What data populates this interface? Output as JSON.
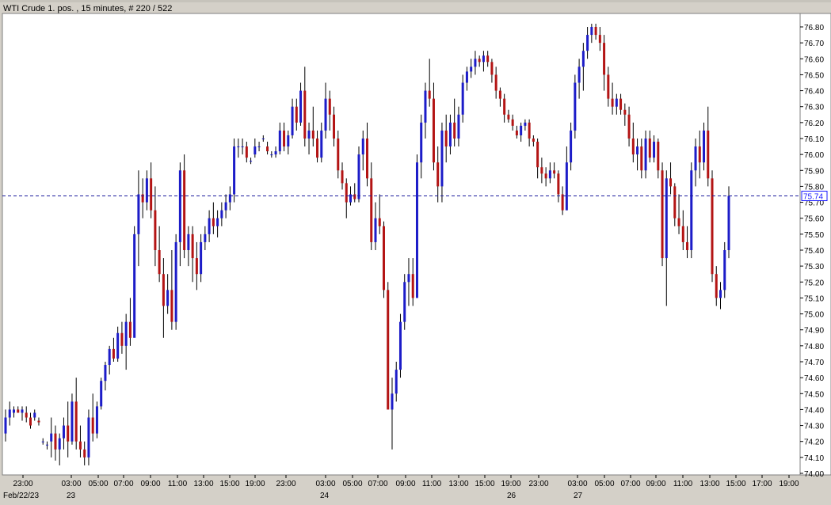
{
  "title": "WTI Crude 1. pos. , 15 minutes, # 220 / 522",
  "colors": {
    "up": "#1c1cc8",
    "down": "#b31414",
    "current_line": "#1a1a9c",
    "plot_bg": "#ffffff",
    "frame_bg": "#d4d0c8"
  },
  "chart_data": {
    "type": "candlestick",
    "timeframe": "15 minutes",
    "ylim": [
      74.0,
      76.85
    ],
    "y_ticks": [
      "74.00",
      "74.10",
      "74.20",
      "74.30",
      "74.40",
      "74.50",
      "74.60",
      "74.70",
      "74.80",
      "74.90",
      "75.00",
      "75.10",
      "75.20",
      "75.30",
      "75.40",
      "75.50",
      "75.60",
      "75.70",
      "75.80",
      "75.90",
      "76.00",
      "76.10",
      "76.20",
      "76.30",
      "76.40",
      "76.50",
      "76.60",
      "76.70",
      "76.80"
    ],
    "x_ticks": [
      "23:00",
      "03:00",
      "05:00",
      "07:00",
      "09:00",
      "11:00",
      "13:00",
      "15:00",
      "19:00",
      "23:00",
      "03:00",
      "05:00",
      "07:00",
      "09:00",
      "11:00",
      "13:00",
      "15:00",
      "19:00",
      "23:00",
      "03:00",
      "05:00",
      "07:00",
      "09:00",
      "11:00",
      "13:00",
      "15:00",
      "17:00",
      "19:00"
    ],
    "date_labels": [
      "Feb/22/23",
      "23",
      "24",
      "26",
      "27"
    ],
    "current_price": "75.74",
    "grid": false,
    "candles": [
      [
        74.25,
        74.4,
        74.2,
        74.35
      ],
      [
        74.35,
        74.45,
        74.3,
        74.4
      ],
      [
        74.38,
        74.42,
        74.35,
        74.4
      ],
      [
        74.4,
        74.42,
        74.38,
        74.38
      ],
      [
        74.38,
        74.42,
        74.33,
        74.4
      ],
      [
        74.38,
        74.42,
        74.32,
        74.35
      ],
      [
        74.35,
        74.38,
        74.28,
        74.3
      ],
      [
        74.35,
        74.4,
        74.33,
        74.38
      ],
      [
        74.33,
        74.35,
        74.3,
        74.32
      ],
      [
        74.2,
        74.22,
        74.18,
        74.2
      ],
      [
        74.18,
        74.2,
        74.15,
        74.18
      ],
      [
        74.2,
        74.35,
        74.1,
        74.25
      ],
      [
        74.25,
        74.3,
        74.08,
        74.15
      ],
      [
        74.15,
        74.25,
        74.05,
        74.22
      ],
      [
        74.22,
        74.35,
        74.15,
        74.3
      ],
      [
        74.3,
        74.45,
        74.1,
        74.2
      ],
      [
        74.2,
        74.5,
        74.18,
        74.45
      ],
      [
        74.45,
        74.6,
        74.15,
        74.2
      ],
      [
        74.2,
        74.3,
        74.1,
        74.15
      ],
      [
        74.15,
        74.2,
        74.05,
        74.1
      ],
      [
        74.1,
        74.4,
        74.05,
        74.35
      ],
      [
        74.35,
        74.5,
        74.2,
        74.25
      ],
      [
        74.25,
        74.45,
        74.22,
        74.42
      ],
      [
        74.42,
        74.6,
        74.4,
        74.58
      ],
      [
        74.58,
        74.7,
        74.52,
        74.68
      ],
      [
        74.68,
        74.8,
        74.62,
        74.78
      ],
      [
        74.78,
        74.85,
        74.7,
        74.72
      ],
      [
        74.72,
        74.92,
        74.7,
        74.88
      ],
      [
        74.88,
        74.95,
        74.75,
        74.8
      ],
      [
        74.8,
        75.0,
        74.65,
        74.95
      ],
      [
        74.95,
        75.1,
        74.8,
        74.85
      ],
      [
        74.85,
        75.55,
        74.9,
        75.5
      ],
      [
        75.5,
        75.9,
        75.3,
        75.75
      ],
      [
        75.75,
        75.85,
        75.6,
        75.7
      ],
      [
        75.7,
        75.9,
        75.65,
        75.85
      ],
      [
        75.85,
        75.95,
        75.6,
        75.65
      ],
      [
        75.65,
        75.8,
        75.3,
        75.4
      ],
      [
        75.4,
        75.55,
        75.2,
        75.25
      ],
      [
        75.25,
        75.35,
        74.85,
        75.05
      ],
      [
        75.05,
        75.25,
        75.0,
        75.15
      ],
      [
        75.15,
        75.4,
        74.9,
        74.95
      ],
      [
        74.95,
        75.5,
        74.9,
        75.45
      ],
      [
        75.45,
        75.95,
        75.3,
        75.9
      ],
      [
        75.9,
        76.0,
        75.35,
        75.4
      ],
      [
        75.4,
        75.55,
        75.3,
        75.5
      ],
      [
        75.5,
        75.55,
        75.2,
        75.35
      ],
      [
        75.35,
        75.45,
        75.15,
        75.25
      ],
      [
        75.25,
        75.5,
        75.2,
        75.45
      ],
      [
        75.45,
        75.55,
        75.4,
        75.5
      ],
      [
        75.5,
        75.65,
        75.45,
        75.6
      ],
      [
        75.6,
        75.7,
        75.5,
        75.55
      ],
      [
        75.55,
        75.65,
        75.48,
        75.6
      ],
      [
        75.6,
        75.7,
        75.55,
        75.65
      ],
      [
        75.65,
        75.75,
        75.6,
        75.7
      ],
      [
        75.7,
        75.8,
        75.65,
        75.75
      ],
      [
        75.75,
        76.1,
        75.7,
        76.05
      ],
      [
        76.05,
        76.1,
        75.98,
        76.05
      ],
      [
        76.05,
        76.1,
        76.0,
        76.05
      ],
      [
        76.05,
        76.08,
        75.95,
        75.98
      ],
      [
        75.96,
        75.98,
        75.94,
        75.96
      ],
      [
        76.0,
        76.1,
        75.98,
        76.05
      ],
      [
        76.05,
        76.08,
        76.02,
        76.05
      ],
      [
        76.1,
        76.12,
        76.08,
        76.1
      ],
      [
        76.05,
        76.08,
        76.0,
        76.02
      ],
      [
        76.0,
        76.02,
        75.98,
        76.0
      ],
      [
        76.0,
        76.05,
        75.98,
        76.02
      ],
      [
        76.02,
        76.2,
        76.0,
        76.15
      ],
      [
        76.15,
        76.2,
        76.02,
        76.05
      ],
      [
        76.05,
        76.15,
        76.0,
        76.12
      ],
      [
        76.12,
        76.35,
        76.1,
        76.3
      ],
      [
        76.3,
        76.35,
        76.15,
        76.2
      ],
      [
        76.2,
        76.45,
        76.18,
        76.4
      ],
      [
        76.4,
        76.55,
        76.05,
        76.1
      ],
      [
        76.1,
        76.2,
        76.0,
        76.15
      ],
      [
        76.15,
        76.3,
        76.05,
        76.1
      ],
      [
        76.1,
        76.15,
        75.95,
        75.98
      ],
      [
        75.98,
        76.2,
        75.95,
        76.15
      ],
      [
        76.15,
        76.45,
        76.1,
        76.35
      ],
      [
        76.35,
        76.4,
        76.15,
        76.25
      ],
      [
        76.25,
        76.3,
        76.05,
        76.1
      ],
      [
        76.1,
        76.15,
        75.85,
        75.9
      ],
      [
        75.9,
        75.95,
        75.78,
        75.82
      ],
      [
        75.82,
        75.85,
        75.6,
        75.7
      ],
      [
        75.7,
        75.8,
        75.68,
        75.75
      ],
      [
        75.75,
        75.82,
        75.7,
        75.72
      ],
      [
        75.72,
        76.05,
        75.7,
        76.0
      ],
      [
        76.0,
        76.15,
        75.9,
        76.1
      ],
      [
        76.1,
        76.2,
        75.8,
        75.85
      ],
      [
        75.85,
        75.95,
        75.4,
        75.45
      ],
      [
        75.45,
        75.7,
        75.4,
        75.6
      ],
      [
        75.6,
        75.75,
        75.5,
        75.55
      ],
      [
        75.55,
        75.58,
        75.1,
        75.15
      ],
      [
        75.15,
        75.2,
        74.65,
        74.4
      ],
      [
        74.4,
        74.6,
        74.15,
        74.5
      ],
      [
        74.5,
        74.7,
        74.45,
        74.65
      ],
      [
        74.65,
        75.0,
        74.6,
        74.95
      ],
      [
        74.95,
        75.25,
        74.9,
        75.2
      ],
      [
        75.2,
        75.35,
        75.05,
        75.25
      ],
      [
        75.25,
        75.35,
        75.05,
        75.1
      ],
      [
        75.1,
        76.0,
        75.1,
        75.95
      ],
      [
        75.95,
        76.25,
        75.85,
        76.2
      ],
      [
        76.2,
        76.45,
        76.1,
        76.4
      ],
      [
        76.4,
        76.6,
        76.3,
        76.35
      ],
      [
        76.35,
        76.45,
        75.9,
        75.95
      ],
      [
        75.95,
        76.05,
        75.7,
        75.8
      ],
      [
        75.8,
        76.2,
        75.7,
        76.15
      ],
      [
        76.15,
        76.25,
        75.95,
        76.05
      ],
      [
        76.05,
        76.25,
        76.0,
        76.2
      ],
      [
        76.2,
        76.35,
        76.05,
        76.1
      ],
      [
        76.1,
        76.3,
        76.05,
        76.25
      ],
      [
        76.25,
        76.5,
        76.2,
        76.45
      ],
      [
        76.45,
        76.55,
        76.4,
        76.52
      ],
      [
        76.52,
        76.6,
        76.48,
        76.55
      ],
      [
        76.55,
        76.65,
        76.5,
        76.6
      ],
      [
        76.6,
        76.62,
        76.55,
        76.58
      ],
      [
        76.58,
        76.65,
        76.52,
        76.62
      ],
      [
        76.62,
        76.65,
        76.55,
        76.58
      ],
      [
        76.58,
        76.6,
        76.45,
        76.5
      ],
      [
        76.5,
        76.55,
        76.35,
        76.4
      ],
      [
        76.4,
        76.42,
        76.3,
        76.35
      ],
      [
        76.35,
        76.38,
        76.2,
        76.25
      ],
      [
        76.25,
        76.28,
        76.2,
        76.22
      ],
      [
        76.22,
        76.25,
        76.15,
        76.18
      ],
      [
        76.15,
        76.18,
        76.1,
        76.12
      ],
      [
        76.12,
        76.2,
        76.08,
        76.18
      ],
      [
        76.18,
        76.22,
        76.15,
        76.2
      ],
      [
        76.2,
        76.22,
        76.05,
        76.1
      ],
      [
        76.1,
        76.12,
        76.05,
        76.08
      ],
      [
        76.08,
        76.1,
        75.85,
        75.92
      ],
      [
        75.92,
        75.98,
        75.82,
        75.88
      ],
      [
        75.88,
        75.92,
        75.8,
        75.85
      ],
      [
        75.85,
        75.95,
        75.82,
        75.9
      ],
      [
        75.9,
        75.95,
        75.85,
        75.88
      ],
      [
        75.88,
        75.9,
        75.7,
        75.75
      ],
      [
        75.75,
        75.8,
        75.62,
        75.65
      ],
      [
        75.65,
        76.05,
        75.65,
        75.95
      ],
      [
        75.95,
        76.2,
        75.9,
        76.15
      ],
      [
        76.15,
        76.5,
        76.1,
        76.45
      ],
      [
        76.45,
        76.6,
        76.35,
        76.55
      ],
      [
        76.55,
        76.7,
        76.4,
        76.65
      ],
      [
        76.65,
        76.8,
        76.6,
        76.75
      ],
      [
        76.75,
        76.82,
        76.7,
        76.8
      ],
      [
        76.8,
        76.82,
        76.72,
        76.75
      ],
      [
        76.75,
        76.8,
        76.65,
        76.7
      ],
      [
        76.7,
        76.75,
        76.4,
        76.5
      ],
      [
        76.5,
        76.55,
        76.3,
        76.35
      ],
      [
        76.35,
        76.45,
        76.25,
        76.3
      ],
      [
        76.3,
        76.38,
        76.25,
        76.35
      ],
      [
        76.35,
        76.38,
        76.25,
        76.28
      ],
      [
        76.28,
        76.32,
        76.18,
        76.25
      ],
      [
        76.25,
        76.3,
        76.05,
        76.1
      ],
      [
        76.1,
        76.2,
        75.95,
        76.0
      ],
      [
        76.0,
        76.1,
        75.9,
        76.05
      ],
      [
        76.05,
        76.1,
        75.85,
        75.9
      ],
      [
        75.9,
        76.15,
        75.85,
        76.1
      ],
      [
        76.1,
        76.15,
        75.95,
        75.98
      ],
      [
        75.98,
        76.12,
        75.95,
        76.08
      ],
      [
        76.08,
        76.1,
        75.85,
        75.9
      ],
      [
        75.9,
        75.95,
        75.3,
        75.35
      ],
      [
        75.35,
        75.9,
        75.05,
        75.85
      ],
      [
        75.85,
        75.95,
        75.75,
        75.8
      ],
      [
        75.8,
        75.82,
        75.55,
        75.6
      ],
      [
        75.6,
        75.75,
        75.5,
        75.55
      ],
      [
        75.55,
        75.65,
        75.4,
        75.45
      ],
      [
        75.45,
        75.55,
        75.35,
        75.4
      ],
      [
        75.4,
        75.95,
        75.35,
        75.9
      ],
      [
        75.9,
        76.1,
        75.8,
        76.05
      ],
      [
        76.05,
        76.15,
        75.85,
        75.95
      ],
      [
        75.95,
        76.2,
        75.9,
        76.15
      ],
      [
        76.15,
        76.3,
        75.8,
        75.85
      ],
      [
        75.85,
        75.9,
        75.2,
        75.25
      ],
      [
        75.25,
        75.3,
        75.05,
        75.1
      ],
      [
        75.1,
        75.2,
        75.03,
        75.15
      ],
      [
        75.15,
        75.45,
        75.1,
        75.4
      ],
      [
        75.4,
        75.8,
        75.35,
        75.74
      ]
    ]
  }
}
